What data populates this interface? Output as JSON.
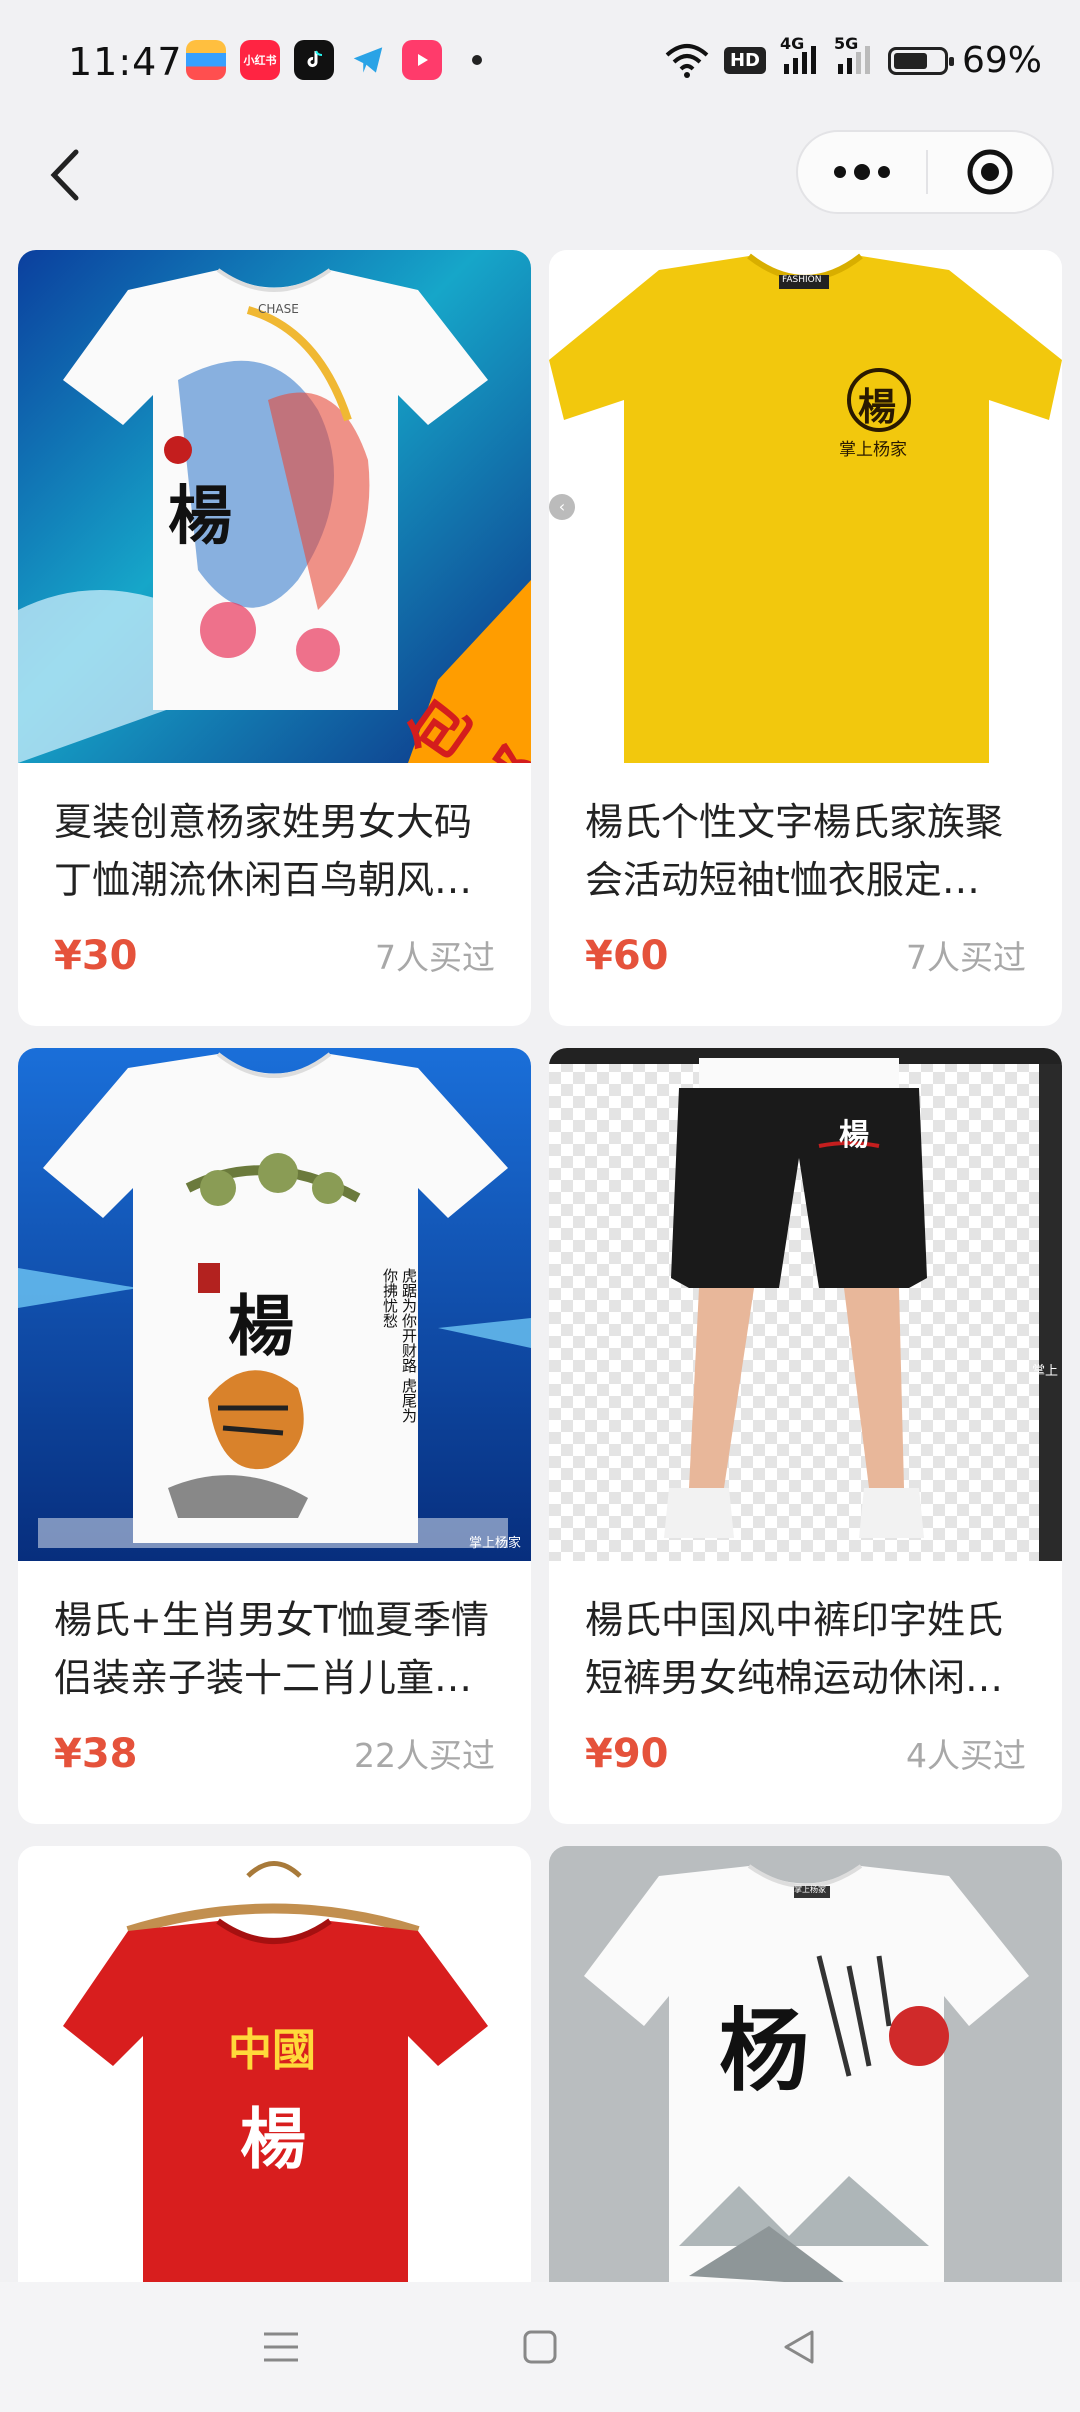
{
  "status": {
    "time": "11:47",
    "hd": "HD",
    "net1": "4G",
    "net2": "5G",
    "battery": "69%",
    "app_icons": [
      "wallet-icon",
      "xiaohongshu-icon",
      "tiktok-icon",
      "telegram-icon",
      "video-icon"
    ],
    "xhs_label": "小红书"
  },
  "products": [
    {
      "title": "夏装创意杨家姓男女大码丁恤潮流休闲百鸟朝风…",
      "price": "¥30",
      "sold": "7人买过",
      "badge": "包邮",
      "shirt_char": "楊",
      "brand_tag": "CHASE"
    },
    {
      "title": "楊氏个性文字楊氏家族聚会活动短袖t恤衣服定…",
      "price": "¥60",
      "sold": "7人买过",
      "shirt_char": "楊",
      "shirt_sub": "掌上杨家",
      "brand_tag": "FASHION"
    },
    {
      "title": "楊氏+生肖男女T恤夏季情侣装亲子装十二肖儿童…",
      "price": "¥38",
      "sold": "22人买过",
      "shirt_char": "楊",
      "poem": "虎踞为你开财路 虎尾为你拂忧愁",
      "watermark": "掌上杨家"
    },
    {
      "title": "楊氏中国风中裤印字姓氏短裤男女纯棉运动休闲…",
      "price": "¥90",
      "sold": "4人买过",
      "shirt_char": "楊",
      "watermark": "掌上"
    },
    {
      "shirt_char": "楊",
      "shirt_sub": "中國"
    },
    {
      "shirt_char": "杨",
      "brand_tag": "掌上杨家"
    }
  ]
}
